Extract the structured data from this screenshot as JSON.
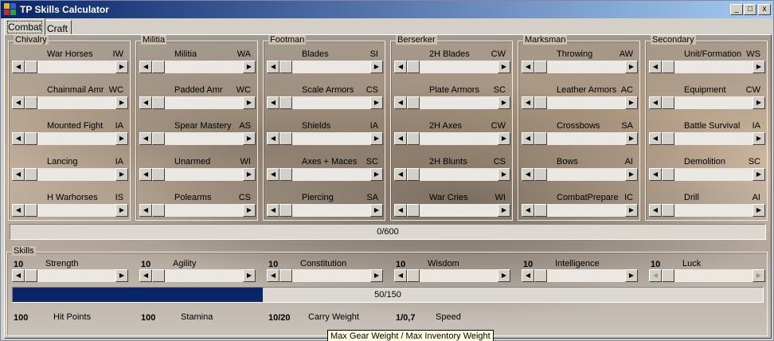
{
  "window": {
    "title": "TP Skills Calculator",
    "minimize_glyph": "_",
    "maximize_glyph": "□",
    "close_glyph": "x"
  },
  "tabs": [
    {
      "label": "Combat",
      "active": true
    },
    {
      "label": "Craft",
      "active": false
    }
  ],
  "groups": [
    {
      "title": "Chivalry",
      "skills": [
        {
          "name": "War Horses",
          "code": "IW"
        },
        {
          "name": "Chainmail Amr",
          "code": "WC"
        },
        {
          "name": "Mounted Fight",
          "code": "IA"
        },
        {
          "name": "Lancing",
          "code": "IA"
        },
        {
          "name": "H Warhorses",
          "code": "IS"
        }
      ]
    },
    {
      "title": "Militia",
      "skills": [
        {
          "name": "Militia",
          "code": "WA"
        },
        {
          "name": "Padded Amr",
          "code": "WC"
        },
        {
          "name": "Spear Mastery",
          "code": "AS"
        },
        {
          "name": "Unarmed",
          "code": "WI"
        },
        {
          "name": "Polearms",
          "code": "CS"
        }
      ]
    },
    {
      "title": "Footman",
      "skills": [
        {
          "name": "Blades",
          "code": "SI"
        },
        {
          "name": "Scale Armors",
          "code": "CS"
        },
        {
          "name": "Shields",
          "code": "IA"
        },
        {
          "name": "Axes + Maces",
          "code": "SC"
        },
        {
          "name": "Piercing",
          "code": "SA"
        }
      ]
    },
    {
      "title": "Berserker",
      "skills": [
        {
          "name": "2H Blades",
          "code": "CW"
        },
        {
          "name": "Plate Armors",
          "code": "SC"
        },
        {
          "name": "2H Axes",
          "code": "CW"
        },
        {
          "name": "2H Blunts",
          "code": "CS"
        },
        {
          "name": "War Cries",
          "code": "WI"
        }
      ]
    },
    {
      "title": "Marksman",
      "skills": [
        {
          "name": "Throwing",
          "code": "AW"
        },
        {
          "name": "Leather Armors",
          "code": "AC"
        },
        {
          "name": "Crossbows",
          "code": "SA"
        },
        {
          "name": "Bows",
          "code": "AI"
        },
        {
          "name": "CombatPrepare",
          "code": "IC"
        }
      ]
    },
    {
      "title": "Secondary",
      "skills": [
        {
          "name": "Unit/Formation",
          "code": "WS"
        },
        {
          "name": "Equipment",
          "code": "CW"
        },
        {
          "name": "Battle Survival",
          "code": "IA"
        },
        {
          "name": "Demolition",
          "code": "SC"
        },
        {
          "name": "Drill",
          "code": "AI"
        }
      ]
    }
  ],
  "combat_points": {
    "text": "0/600",
    "value": 0,
    "max": 600
  },
  "skills_group": {
    "title": "Skills",
    "attributes": [
      {
        "value": "10",
        "name": "Strength"
      },
      {
        "value": "10",
        "name": "Agility"
      },
      {
        "value": "10",
        "name": "Constitution"
      },
      {
        "value": "10",
        "name": "Wisdom"
      },
      {
        "value": "10",
        "name": "Intelligence"
      },
      {
        "value": "10",
        "name": "Luck"
      }
    ],
    "points": {
      "text": "50/150",
      "value": 50,
      "max": 150
    },
    "derived": [
      {
        "value": "100",
        "name": "Hit Points"
      },
      {
        "value": "100",
        "name": "Stamina"
      },
      {
        "value": "10/20",
        "name": "Carry Weight"
      },
      {
        "value": "1/0,7",
        "name": "Speed"
      }
    ]
  },
  "tooltip": "Max Gear Weight / Max Inventory Weight",
  "colors": {
    "titlebar_start": "#0a246a",
    "titlebar_end": "#a6caf0",
    "progress_fill": "#0a246a",
    "tooltip_bg": "#ffffe1"
  }
}
